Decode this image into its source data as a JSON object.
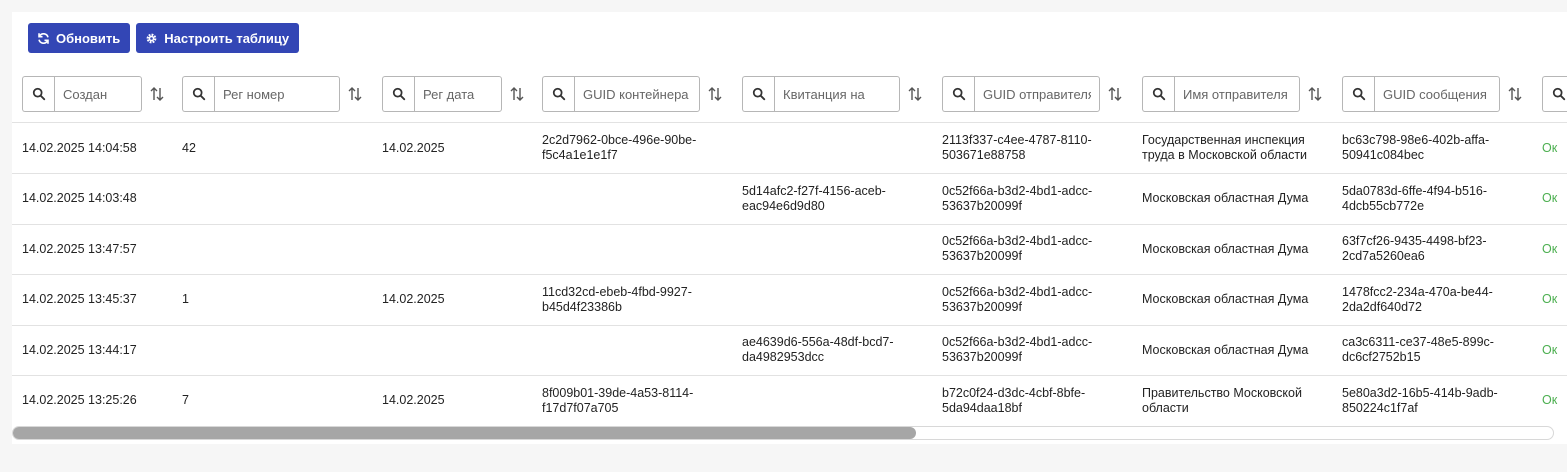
{
  "toolbar": {
    "refresh_label": "Обновить",
    "configure_label": "Настроить таблицу",
    "refresh_icon": "refresh-icon",
    "configure_icon": "gear-icon",
    "accent": "#3346b5"
  },
  "columns": [
    {
      "placeholder": "Создан"
    },
    {
      "placeholder": "Рег номер"
    },
    {
      "placeholder": "Рег дата"
    },
    {
      "placeholder": "GUID контейнера"
    },
    {
      "placeholder": "Квитанция на"
    },
    {
      "placeholder": "GUID отправителя"
    },
    {
      "placeholder": "Имя отправителя"
    },
    {
      "placeholder": "GUID сообщения"
    }
  ],
  "rows": [
    {
      "created": "14.02.2025 14:04:58",
      "reg_number": "42",
      "reg_date": "14.02.2025",
      "container_guid": [
        "2c2d7962-0bce-496e-90be-",
        "f5c4a1e1e1f7"
      ],
      "receipt_for": [
        "",
        ""
      ],
      "sender_guid": [
        "2113f337-c4ee-4787-8110-",
        "503671e88758"
      ],
      "sender_name": [
        "Государственная инспекция",
        "труда в Московской области"
      ],
      "message_guid": [
        "bc63c798-98e6-402b-affa-",
        "50941c084bec"
      ],
      "status": "Ок"
    },
    {
      "created": "14.02.2025 14:03:48",
      "reg_number": "",
      "reg_date": "",
      "container_guid": [
        "",
        ""
      ],
      "receipt_for": [
        "5d14afc2-f27f-4156-aceb-",
        "eac94e6d9d80"
      ],
      "sender_guid": [
        "0c52f66a-b3d2-4bd1-adcc-",
        "53637b20099f"
      ],
      "sender_name": [
        "Московская областная Дума",
        ""
      ],
      "message_guid": [
        "5da0783d-6ffe-4f94-b516-",
        "4dcb55cb772e"
      ],
      "status": "Ок"
    },
    {
      "created": "14.02.2025 13:47:57",
      "reg_number": "",
      "reg_date": "",
      "container_guid": [
        "",
        ""
      ],
      "receipt_for": [
        "",
        ""
      ],
      "sender_guid": [
        "0c52f66a-b3d2-4bd1-adcc-",
        "53637b20099f"
      ],
      "sender_name": [
        "Московская областная Дума",
        ""
      ],
      "message_guid": [
        "63f7cf26-9435-4498-bf23-",
        "2cd7a5260ea6"
      ],
      "status": "Ок"
    },
    {
      "created": "14.02.2025 13:45:37",
      "reg_number": "1",
      "reg_date": "14.02.2025",
      "container_guid": [
        "11cd32cd-ebeb-4fbd-9927-",
        "b45d4f23386b"
      ],
      "receipt_for": [
        "",
        ""
      ],
      "sender_guid": [
        "0c52f66a-b3d2-4bd1-adcc-",
        "53637b20099f"
      ],
      "sender_name": [
        "Московская областная Дума",
        ""
      ],
      "message_guid": [
        "1478fcc2-234a-470a-be44-",
        "2da2df640d72"
      ],
      "status": "Ок"
    },
    {
      "created": "14.02.2025 13:44:17",
      "reg_number": "",
      "reg_date": "",
      "container_guid": [
        "",
        ""
      ],
      "receipt_for": [
        "ae4639d6-556a-48df-bcd7-",
        "da4982953dcc"
      ],
      "sender_guid": [
        "0c52f66a-b3d2-4bd1-adcc-",
        "53637b20099f"
      ],
      "sender_name": [
        "Московская областная Дума",
        ""
      ],
      "message_guid": [
        "ca3c6311-ce37-48e5-899c-",
        "dc6cf2752b15"
      ],
      "status": "Ок"
    },
    {
      "created": "14.02.2025 13:25:26",
      "reg_number": "7",
      "reg_date": "14.02.2025",
      "container_guid": [
        "8f009b01-39de-4a53-8114-",
        "f17d7f07a705"
      ],
      "receipt_for": [
        "",
        ""
      ],
      "sender_guid": [
        "b72c0f24-d3dc-4cbf-8bfe-",
        "5da94daa18bf"
      ],
      "sender_name": [
        "Правительство Московской",
        "области"
      ],
      "message_guid": [
        "5e80a3d2-16b5-414b-9adb-",
        "850224c1f7af"
      ],
      "status": "Ок"
    }
  ],
  "status_color": "#4caf50",
  "icons": {
    "filter_search": "search-icon",
    "sort": "sort-arrows-icon"
  },
  "scrollbar": {
    "horizontal_position": 0.0
  }
}
